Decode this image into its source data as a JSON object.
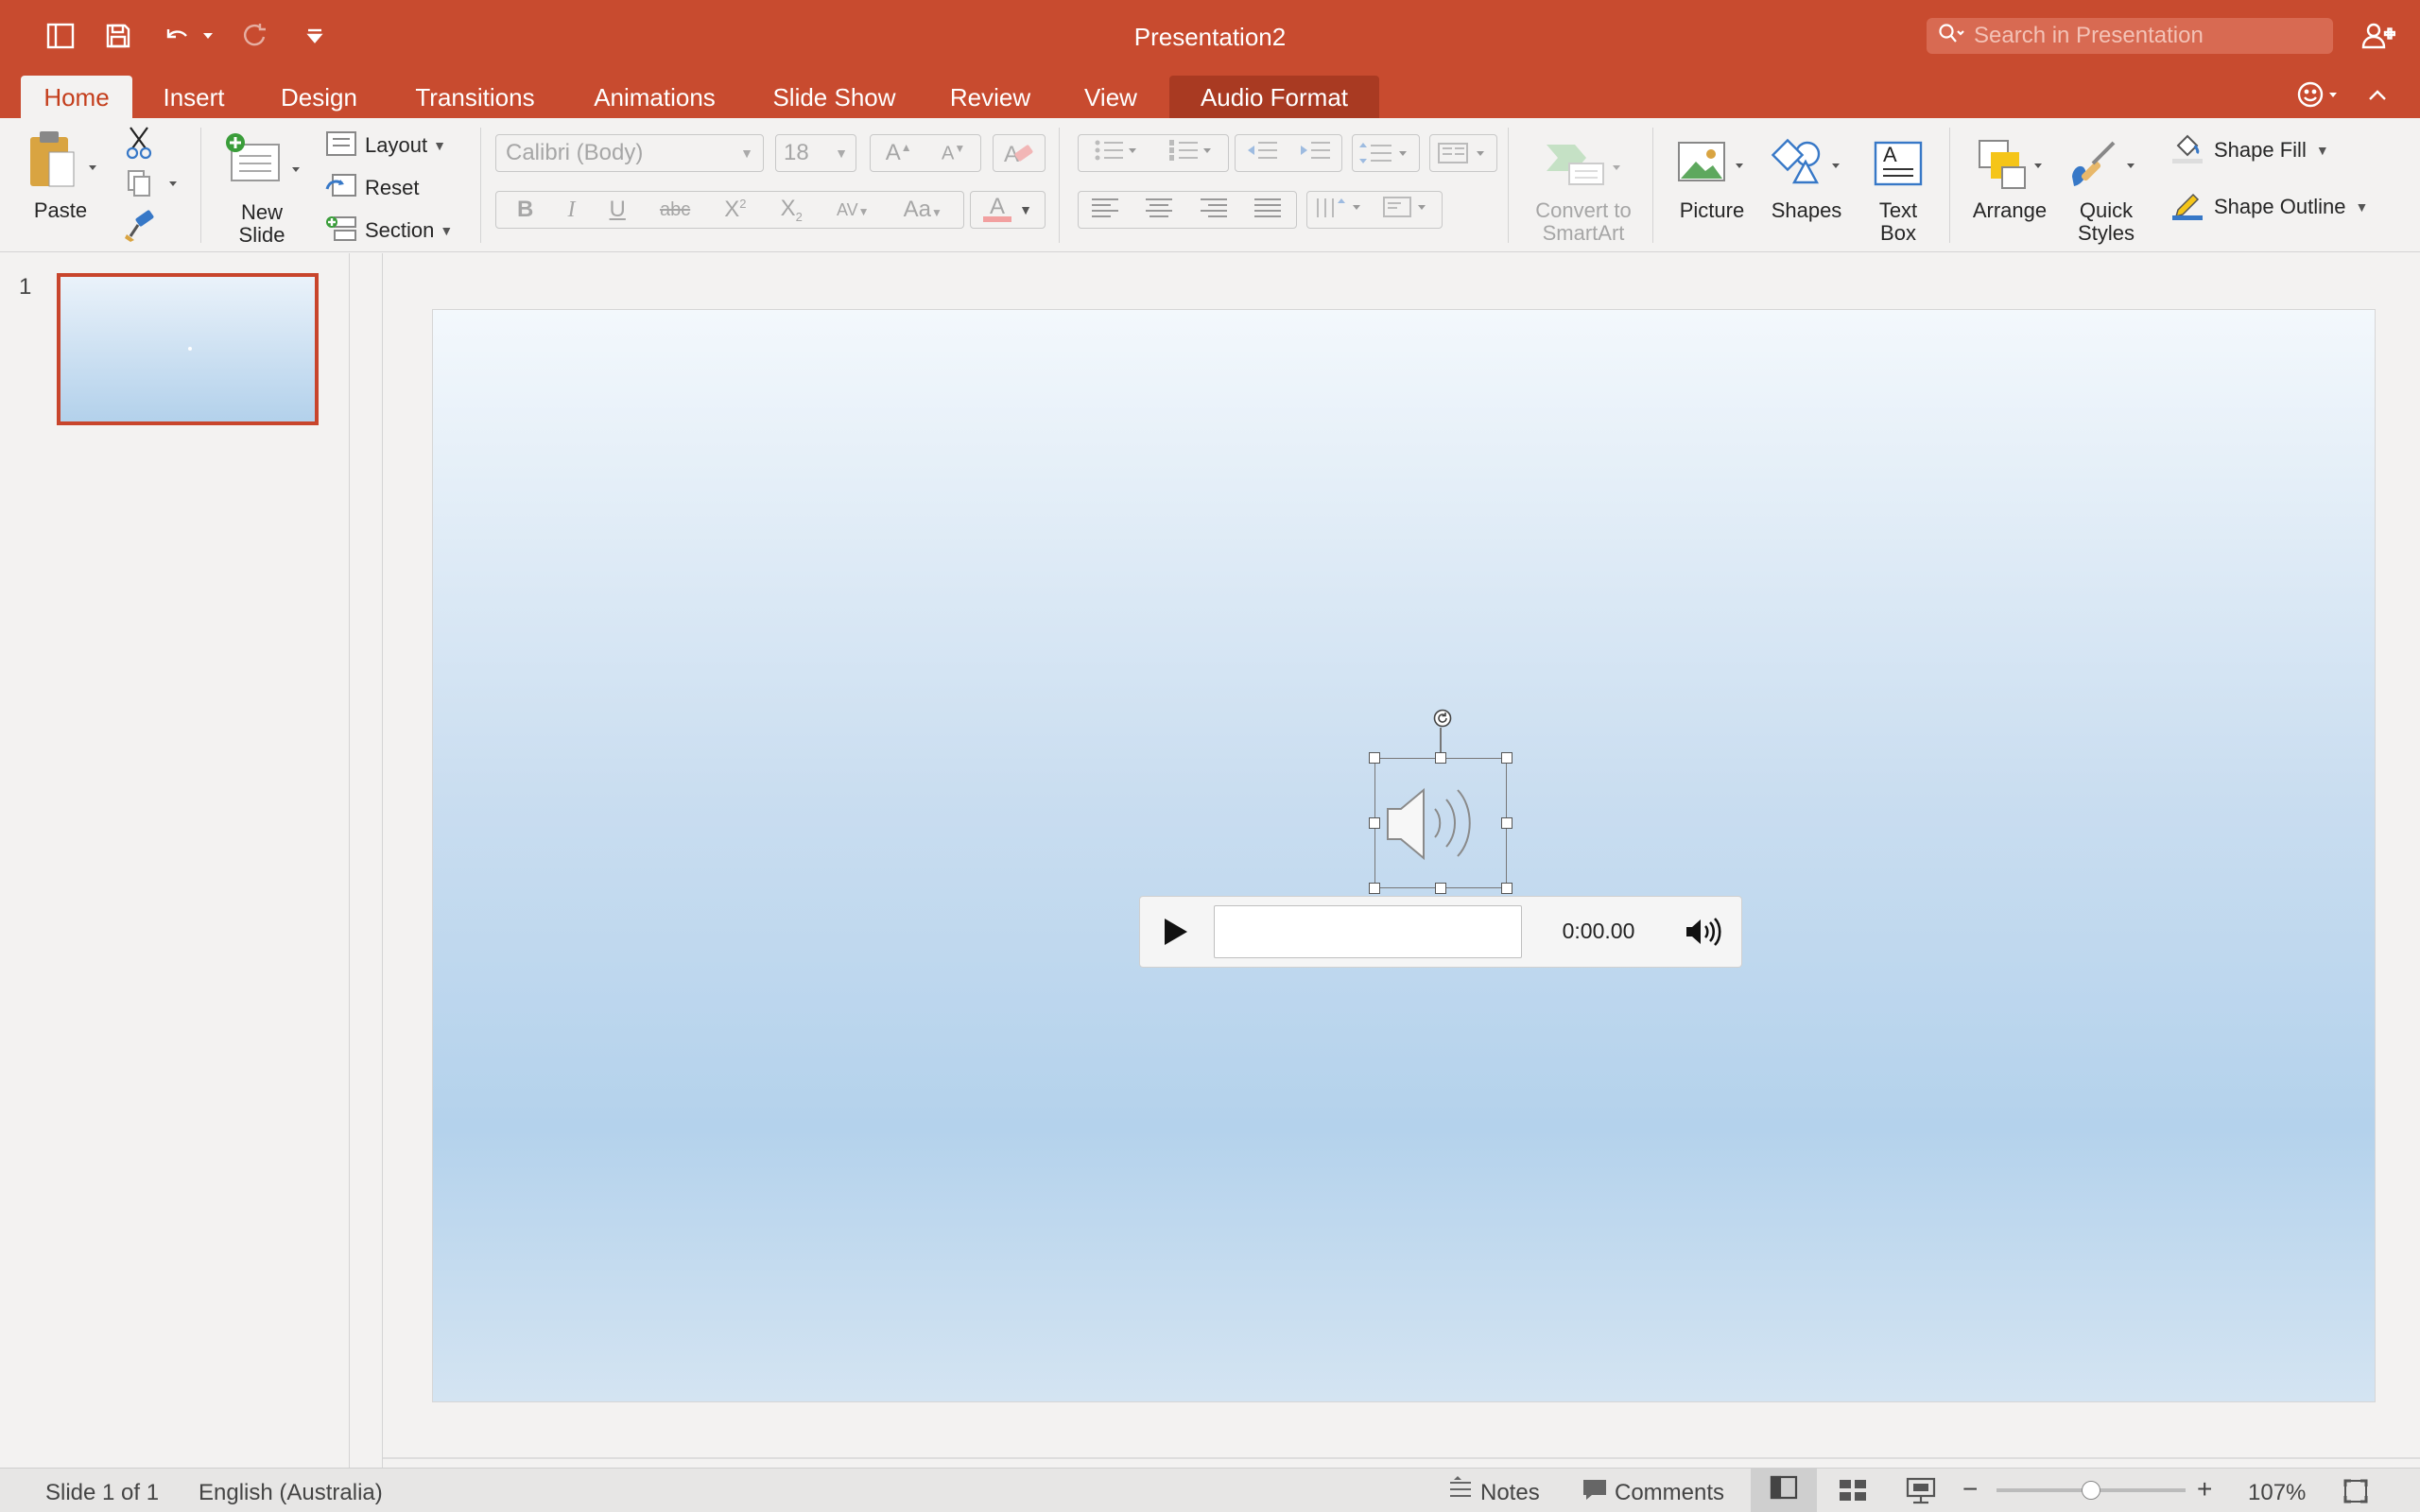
{
  "window": {
    "title": "Presentation2"
  },
  "search": {
    "placeholder": "Search in Presentation"
  },
  "tabs": [
    {
      "label": "Home",
      "active": true
    },
    {
      "label": "Insert"
    },
    {
      "label": "Design"
    },
    {
      "label": "Transitions"
    },
    {
      "label": "Animations"
    },
    {
      "label": "Slide Show"
    },
    {
      "label": "Review"
    },
    {
      "label": "View"
    },
    {
      "label": "Audio Format",
      "contextual": true
    }
  ],
  "ribbon": {
    "paste": "Paste",
    "new_slide_line1": "New",
    "new_slide_line2": "Slide",
    "layout": "Layout",
    "reset": "Reset",
    "section": "Section",
    "font_name": "Calibri (Body)",
    "font_size": "18",
    "convert_line1": "Convert to",
    "convert_line2": "SmartArt",
    "picture": "Picture",
    "shapes": "Shapes",
    "textbox_line1": "Text",
    "textbox_line2": "Box",
    "arrange": "Arrange",
    "quick_styles_line1": "Quick",
    "quick_styles_line2": "Styles",
    "shape_fill": "Shape Fill",
    "shape_outline": "Shape Outline"
  },
  "slides_pane": {
    "slide_number": "1"
  },
  "audio": {
    "time": "0:00.00",
    "progress": 0
  },
  "status": {
    "slide_info": "Slide 1 of 1",
    "language": "English (Australia)",
    "notes": "Notes",
    "comments": "Comments",
    "zoom": "107%",
    "zoom_level": 0.5
  },
  "colors": {
    "accent": "#c84b2f",
    "active_tab_text": "#c43e1c",
    "selection": "#c8452c"
  }
}
